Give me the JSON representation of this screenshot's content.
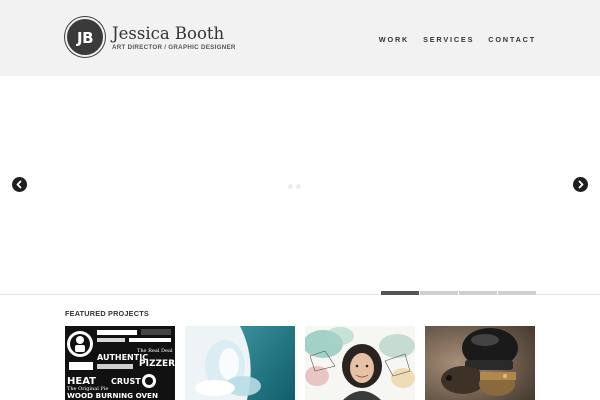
{
  "brand": {
    "logo_initials": "JB",
    "name": "Jessica Booth",
    "tagline": "ART DIRECTOR / GRAPHIC DESIGNER"
  },
  "nav": {
    "items": [
      {
        "label": "WORK"
      },
      {
        "label": "SERVICES"
      },
      {
        "label": "CONTACT"
      }
    ]
  },
  "slider": {
    "prev_icon": "chevron-left-icon",
    "next_icon": "chevron-right-icon",
    "slide_count": 4,
    "active_slide": 1
  },
  "featured": {
    "title": "FEATURED PROJECTS",
    "projects": [
      {
        "image": "pizza-typography-poster",
        "visible_text": [
          "AUTHENTIC",
          "The Real Deal",
          "PIZZERIA",
          "HEAT",
          "CRUST",
          "The Original Pie",
          "WOOD BURNING OVEN"
        ]
      },
      {
        "image": "glass-sculpture-teal"
      },
      {
        "image": "woman-portrait-watercolor"
      },
      {
        "image": "armored-animal-helmet"
      }
    ]
  },
  "colors": {
    "header_bg": "#f2f2f2",
    "logo_bg": "#3a3a3a",
    "active_tab": "#555555",
    "inactive_tab": "#cfcfcf"
  }
}
